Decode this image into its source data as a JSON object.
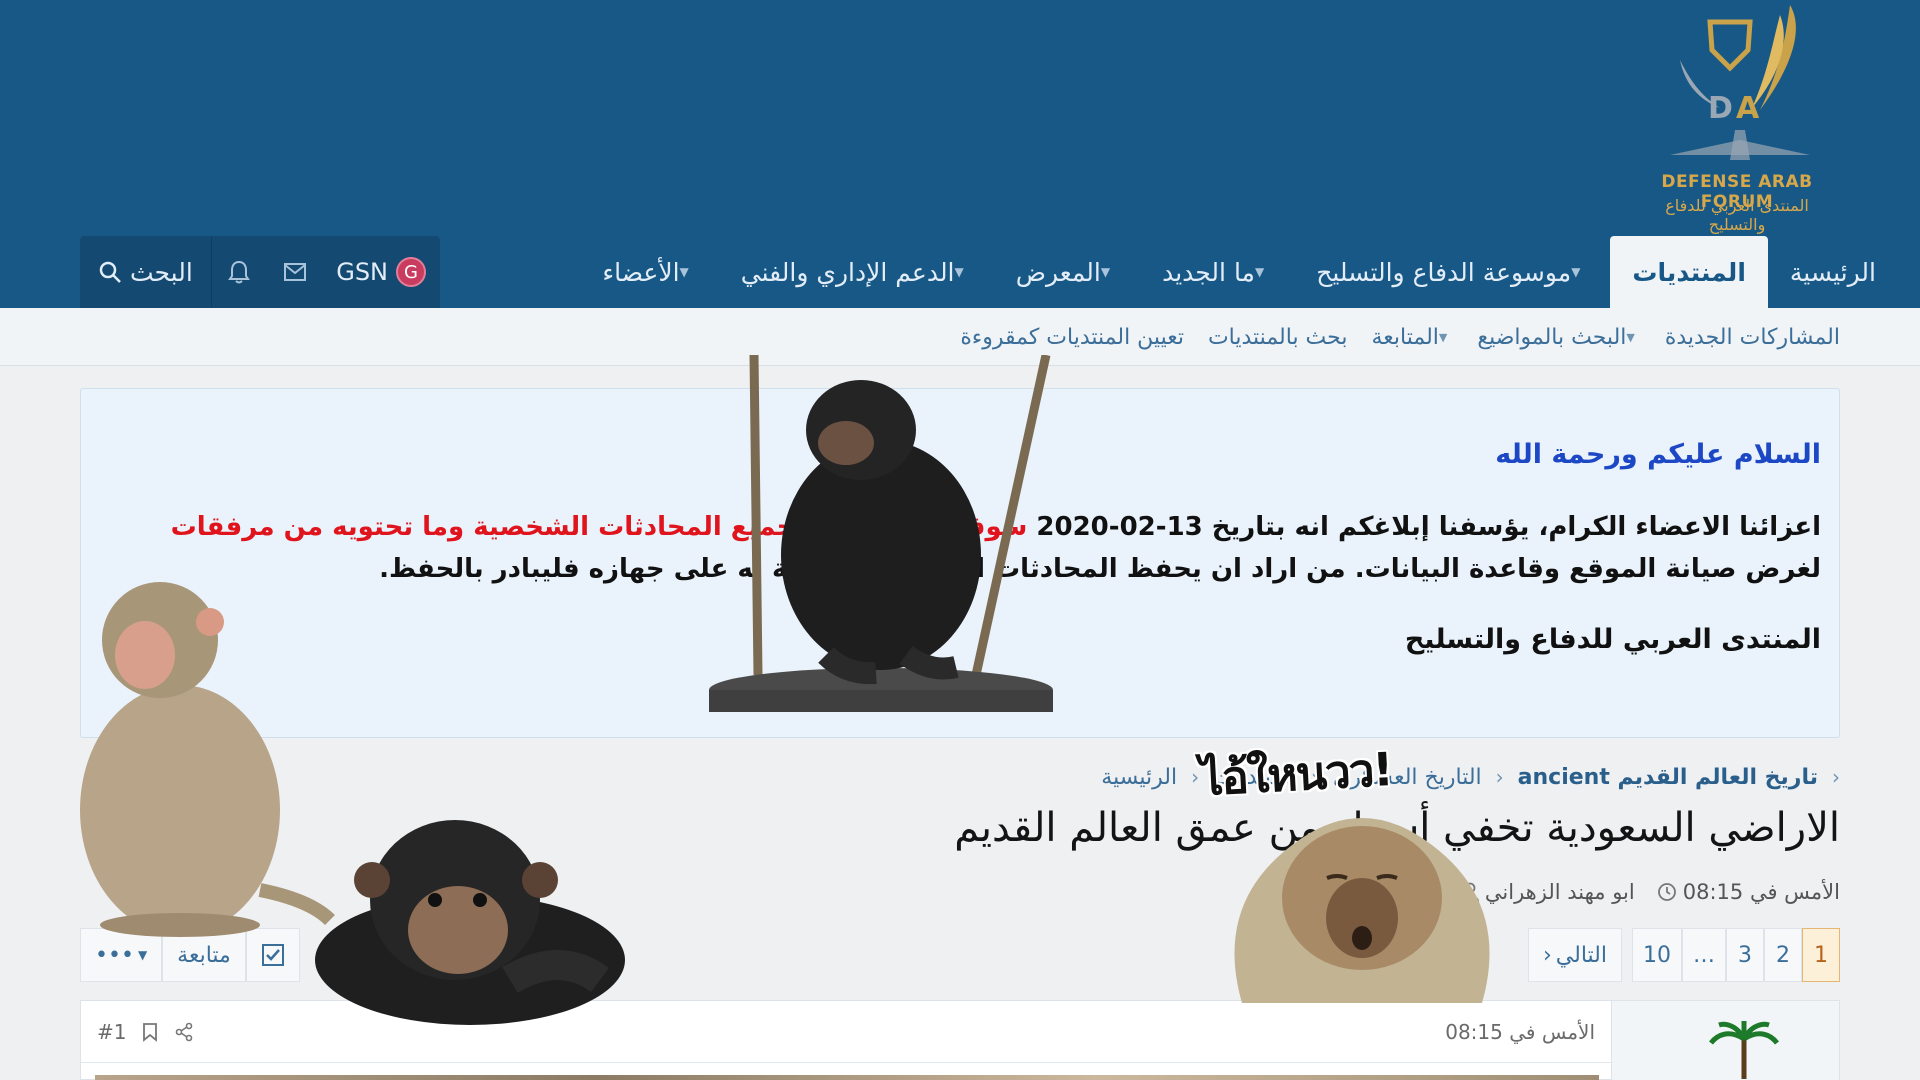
{
  "header": {
    "logo_line1": "DEFENSE ARAB FORUM",
    "logo_line2": "المنتدى العربي للدفاع والتسليح",
    "nav_tabs": [
      {
        "label": "الرئيسية",
        "has_caret": false,
        "active": false
      },
      {
        "label": "المنتديات",
        "has_caret": false,
        "active": true
      },
      {
        "label": "موسوعة الدفاع والتسليح",
        "has_caret": true,
        "active": false
      },
      {
        "label": "ما الجديد",
        "has_caret": true,
        "active": false
      },
      {
        "label": "المعرض",
        "has_caret": true,
        "active": false
      },
      {
        "label": "الدعم الإداري والفني",
        "has_caret": true,
        "active": false
      },
      {
        "label": "الأعضاء",
        "has_caret": true,
        "active": false
      }
    ],
    "user": {
      "avatar_letter": "G",
      "username": "GSN",
      "search_label": "البحث"
    }
  },
  "subnav": {
    "items": [
      {
        "label": "المشاركات الجديدة",
        "has_caret": false
      },
      {
        "label": "البحث بالمواضيع",
        "has_caret": true
      },
      {
        "label": "المتابعة",
        "has_caret": true
      },
      {
        "label": "بحث بالمنتديات",
        "has_caret": false
      },
      {
        "label": "تعيين المنتديات كمقروءة",
        "has_caret": false
      }
    ]
  },
  "notice": {
    "greeting": "السلام عليكم ورحمة الله",
    "para_start": "اعزائنا الاعضاء الكرام، يؤسفنا إبلاغكم انه بتاريخ 13-02-2020 ",
    "para_red": "سوف نقوم بإزالة جميع المحادثات الشخصية وما تحتويه من مرفقات",
    "para_end": " لغرض صيانة الموقع وقاعدة البيانات. من اراد ان يحفظ المحادثات الشخصية الخاصة به على جهازه فليبادر بالحفظ.",
    "signature": "المنتدى العربي للدفاع والتسليح"
  },
  "breadcrumb": {
    "items": [
      {
        "label": "الرئيسية",
        "strong": false
      },
      {
        "label": "المنتديات",
        "strong": false
      },
      {
        "label": "التاريخ العسكري",
        "strong": false
      },
      {
        "label": "تاريخ العالم القديم ancient",
        "strong": true
      }
    ]
  },
  "thread": {
    "title": "الاراضي السعودية تخفي أسرار من عمق العالم القديم",
    "author": "ابو مهند الزهراني",
    "date": "الأمس في 08:15"
  },
  "pagination": {
    "pages": [
      "1",
      "2",
      "3",
      "…",
      "10"
    ],
    "current": "1",
    "next_label": "التالي"
  },
  "thread_actions": {
    "follow_label": "متابعة",
    "more_label": "•••"
  },
  "post": {
    "date": "الأمس في 08:15",
    "number": "#1"
  },
  "overlays": {
    "sticker_text": "ไอ้ใหนวว!"
  },
  "colors": {
    "header_bg": "#185886",
    "accent": "#3b6e99",
    "notice_red": "#e0141c",
    "notice_blue": "#1c47c5",
    "avatar_bg": "#c93b5f"
  }
}
